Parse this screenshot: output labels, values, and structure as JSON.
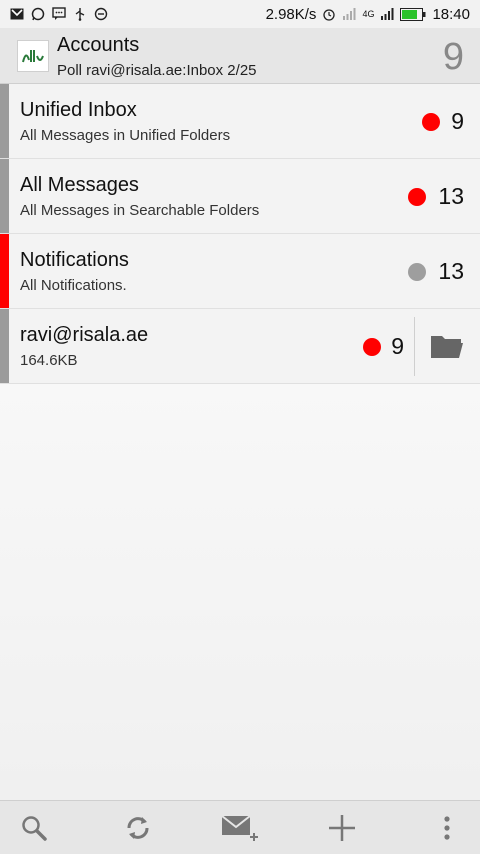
{
  "status_bar": {
    "left_icons": [
      "gmail-icon",
      "whatsapp-icon",
      "message-icon",
      "usb-icon",
      "minus-circle-icon"
    ],
    "speed": "2.98K/s",
    "network": "4G",
    "time": "18:40"
  },
  "header": {
    "title": "Accounts",
    "subtitle": "Poll ravi@risala.ae:Inbox 2/25",
    "count": "9"
  },
  "rows": [
    {
      "title": "Unified Inbox",
      "subtitle": "All Messages in Unified Folders",
      "count": "9",
      "dot_color": "#ff0000"
    },
    {
      "title": "All Messages",
      "subtitle": "All Messages in Searchable Folders",
      "count": "13",
      "dot_color": "#ff0000"
    },
    {
      "title": "Notifications",
      "subtitle": "All Notifications.",
      "count": "13",
      "dot_color": "#9e9e9e"
    },
    {
      "title": "ravi@risala.ae",
      "subtitle": "164.6KB",
      "count": "9",
      "dot_color": "#ff0000"
    }
  ],
  "toolbar": {
    "icons": [
      "search-icon",
      "refresh-icon",
      "compose-icon",
      "add-icon",
      "more-icon"
    ]
  }
}
